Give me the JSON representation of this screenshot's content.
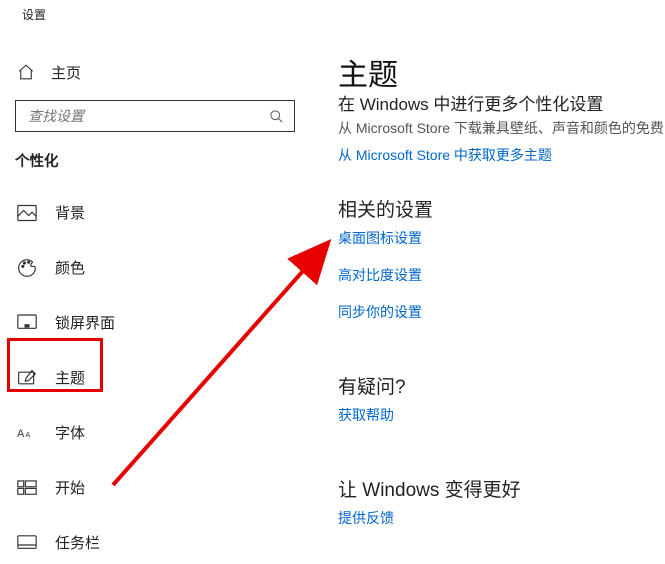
{
  "header": {
    "app_name": "设置"
  },
  "sidebar": {
    "home_label": "主页",
    "search_placeholder": "查找设置",
    "section_title": "个性化",
    "items": [
      {
        "label": "背景"
      },
      {
        "label": "颜色"
      },
      {
        "label": "锁屏界面"
      },
      {
        "label": "主题"
      },
      {
        "label": "字体"
      },
      {
        "label": "开始"
      },
      {
        "label": "任务栏"
      }
    ]
  },
  "main": {
    "title": "主题",
    "subtitle1": "在 Windows 中进行更多个性化设置",
    "subtitle2": "从 Microsoft Store 下载兼具壁纸、声音和颜色的免费",
    "more_link": "从 Microsoft Store 中获取更多主题",
    "related_heading": "相关的设置",
    "related_links": {
      "desktop_icons": "桌面图标设置",
      "high_contrast": "高对比度设置",
      "sync": "同步你的设置"
    },
    "question_heading": "有疑问?",
    "help_link": "获取帮助",
    "better_heading": "让 Windows 变得更好",
    "feedback_link": "提供反馈"
  }
}
